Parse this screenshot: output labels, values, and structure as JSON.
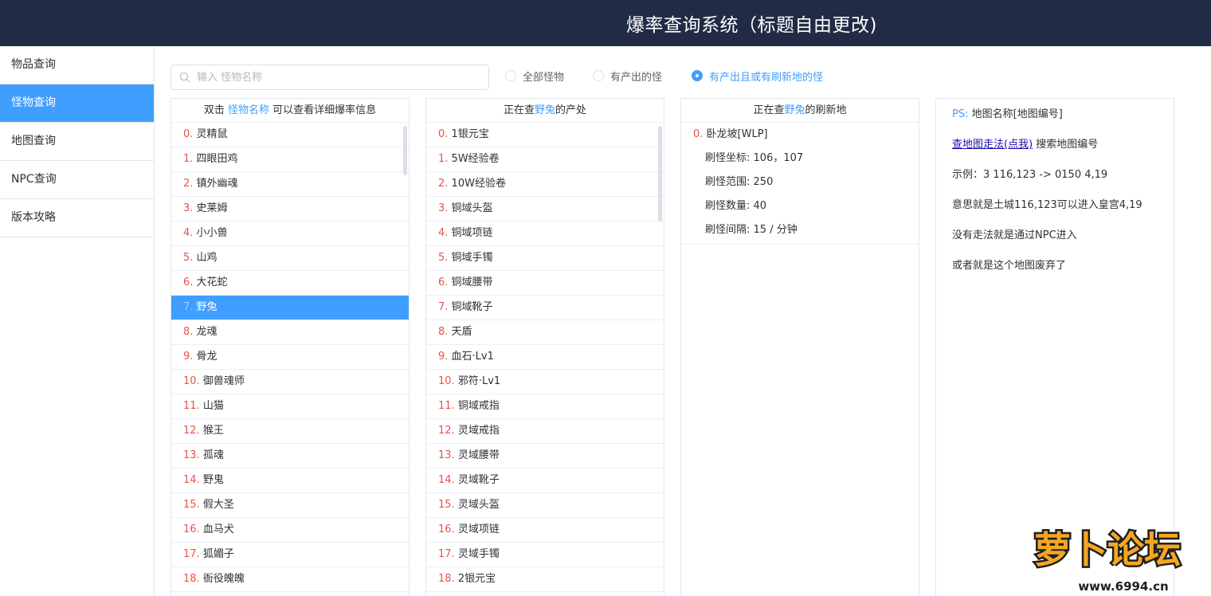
{
  "header": {
    "title": "爆率查询系统（标题自由更改)"
  },
  "sidebar": {
    "items": [
      {
        "label": "物品查询"
      },
      {
        "label": "怪物查询"
      },
      {
        "label": "地图查询"
      },
      {
        "label": "NPC查询"
      },
      {
        "label": "版本攻略"
      }
    ],
    "active_index": 1
  },
  "search": {
    "placeholder": "输入 怪物名称",
    "value": ""
  },
  "filters": {
    "options": [
      {
        "label": "全部怪物",
        "checked": false
      },
      {
        "label": "有产出的怪",
        "checked": false
      },
      {
        "label": "有产出且或有刷新地的怪",
        "checked": true
      }
    ]
  },
  "monster_panel": {
    "head_prefix": "双击",
    "head_highlight": "怪物名称",
    "head_suffix": "可以查看详细爆率信息",
    "selected_index": 7,
    "items": [
      {
        "idx": "0.",
        "name": "灵精鼠"
      },
      {
        "idx": "1.",
        "name": "四眼田鸡"
      },
      {
        "idx": "2.",
        "name": "镇外幽魂"
      },
      {
        "idx": "3.",
        "name": "史莱姆"
      },
      {
        "idx": "4.",
        "name": "小小兽"
      },
      {
        "idx": "5.",
        "name": "山鸡"
      },
      {
        "idx": "6.",
        "name": "大花蛇"
      },
      {
        "idx": "7.",
        "name": "野兔"
      },
      {
        "idx": "8.",
        "name": "龙魂"
      },
      {
        "idx": "9.",
        "name": "骨龙"
      },
      {
        "idx": "10.",
        "name": "御兽魂师"
      },
      {
        "idx": "11.",
        "name": "山猫"
      },
      {
        "idx": "12.",
        "name": "猴王"
      },
      {
        "idx": "13.",
        "name": "孤魂"
      },
      {
        "idx": "14.",
        "name": "野鬼"
      },
      {
        "idx": "15.",
        "name": "假大圣"
      },
      {
        "idx": "16.",
        "name": "血马犬"
      },
      {
        "idx": "17.",
        "name": "狐媚子"
      },
      {
        "idx": "18.",
        "name": "衙役魄魄"
      }
    ]
  },
  "drops_panel": {
    "head_prefix": "正在查",
    "head_highlight": "野兔",
    "head_suffix": "的产处",
    "items": [
      {
        "idx": "0.",
        "name": "1银元宝"
      },
      {
        "idx": "1.",
        "name": "5W经验卷"
      },
      {
        "idx": "2.",
        "name": "10W经验卷"
      },
      {
        "idx": "3.",
        "name": "铜域头盔"
      },
      {
        "idx": "4.",
        "name": "铜域项链"
      },
      {
        "idx": "5.",
        "name": "铜域手镯"
      },
      {
        "idx": "6.",
        "name": "铜域腰带"
      },
      {
        "idx": "7.",
        "name": "铜域靴子"
      },
      {
        "idx": "8.",
        "name": "天盾"
      },
      {
        "idx": "9.",
        "name": "血石·Lv1"
      },
      {
        "idx": "10.",
        "name": "邪符·Lv1"
      },
      {
        "idx": "11.",
        "name": "铜域戒指"
      },
      {
        "idx": "12.",
        "name": "灵域戒指"
      },
      {
        "idx": "13.",
        "name": "灵域腰带"
      },
      {
        "idx": "14.",
        "name": "灵域靴子"
      },
      {
        "idx": "15.",
        "name": "灵域头盔"
      },
      {
        "idx": "16.",
        "name": "灵域项链"
      },
      {
        "idx": "17.",
        "name": "灵域手镯"
      },
      {
        "idx": "18.",
        "name": "2银元宝"
      }
    ]
  },
  "spawn_panel": {
    "head_prefix": "正在查",
    "head_highlight": "野兔",
    "head_suffix": "的刷新地",
    "map_idx": "0.",
    "map_name": "卧龙坡[WLP]",
    "details": [
      {
        "label": "刷怪坐标:",
        "value": "106，107"
      },
      {
        "label": "刷怪范围:",
        "value": "250"
      },
      {
        "label": "刷怪数量:",
        "value": "40"
      },
      {
        "label": "刷怪间隔:",
        "value": "15 / 分钟"
      }
    ]
  },
  "info_panel": {
    "ps_label": "PS:",
    "ps_text": "地图名称[地图编号]",
    "link_text": "查地图走法(点我)",
    "link_suffix": "搜索地图编号",
    "example": "示例：3 116,123 -> 0150 4,19",
    "meaning": "意思就是土城116,123可以进入皇宫4,19",
    "no_route": "没有走法就是通过NPC进入",
    "abandoned": "或者就是这个地图废弃了"
  },
  "watermark": {
    "text": "萝卜论坛",
    "url": "www.6994.cn"
  },
  "colors": {
    "header_bg": "#222b45",
    "accent": "#409eff",
    "index_red": "#e5534b"
  }
}
